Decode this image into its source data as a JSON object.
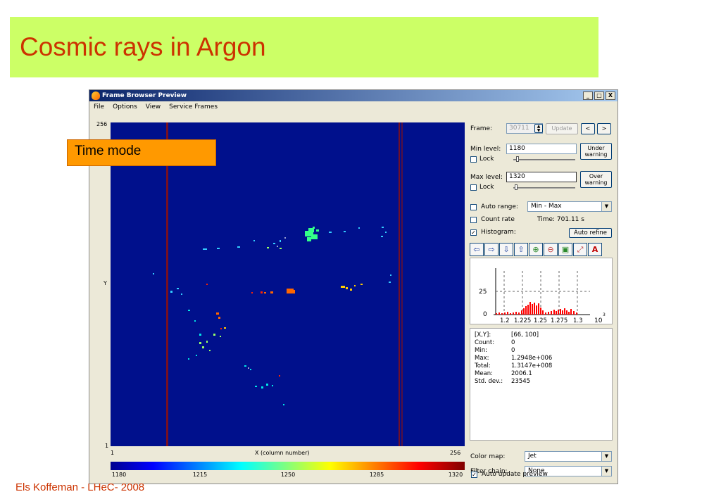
{
  "slide": {
    "title": "Cosmic rays in Argon",
    "footer": "Els Koffeman - LHeC- 2008",
    "callout": "Time mode"
  },
  "window": {
    "title": "Frame Browser Preview",
    "menu": [
      "File",
      "Options",
      "View",
      "Service Frames"
    ],
    "controls": {
      "minimize": "_",
      "maximize": "□",
      "close": "X"
    }
  },
  "plot": {
    "y_top": "256",
    "y_label": "Y",
    "y_bottom": "1",
    "x_left": "1",
    "x_label": "X (column number)",
    "x_right": "256",
    "colorbar_ticks": [
      "1180",
      "1215",
      "1250",
      "1285",
      "1320"
    ]
  },
  "panel": {
    "frame_label": "Frame:",
    "frame_value": "30711",
    "update_label": "Update",
    "prev_label": "<",
    "next_label": ">",
    "min_level_label": "Min level:",
    "min_level_value": "1180",
    "under_warning_label_1": "Under",
    "under_warning_label_2": "warning",
    "lock_label": "Lock",
    "max_level_label": "Max level:",
    "max_level_value": "1320",
    "over_warning_label_1": "Over",
    "over_warning_label_2": "warning",
    "auto_range_label": "Auto range:",
    "auto_range_value": "Min - Max",
    "count_rate_label": "Count rate",
    "time_text": "Time: 701.11 s",
    "histogram_label": "Histogram:",
    "histogram_checked": true,
    "auto_refine_label": "Auto refine",
    "toolbar_icons": [
      "arrow-left-icon",
      "arrow-right-icon",
      "arrow-down-icon",
      "arrow-up-icon",
      "zoom-in-icon",
      "zoom-out-icon",
      "zoom-region-icon",
      "zoom-fit-icon",
      "auto-scale-icon"
    ],
    "color_map_label": "Color map:",
    "color_map_value": "Jet",
    "filter_chain_label": "Filter chain:",
    "filter_chain_value": "None",
    "auto_update_label": "Auto update preview",
    "auto_update_checked": true
  },
  "histogram": {
    "y_ticks": [
      "25",
      "0"
    ],
    "x_ticks": [
      "1.2",
      "1.225",
      "1.25",
      "1.275",
      "1.3"
    ],
    "x_multiplier": "10",
    "x_exponent": "3",
    "bar_color": "#ff0000"
  },
  "stats": [
    {
      "key": "[X,Y]:",
      "value": "[66, 100]"
    },
    {
      "key": "Count:",
      "value": "0"
    },
    {
      "key": "Min:",
      "value": "0"
    },
    {
      "key": "Max:",
      "value": "1.2948e+006"
    },
    {
      "key": "Total:",
      "value": "1.3147e+008"
    },
    {
      "key": "Mean:",
      "value": "2006.1"
    },
    {
      "key": "Std. dev.:",
      "value": "23545"
    }
  ],
  "colors": {
    "title_band": "#ccff66",
    "title_text": "#cc3300",
    "plot_background": "#00108c",
    "callout": "#ff9900"
  }
}
